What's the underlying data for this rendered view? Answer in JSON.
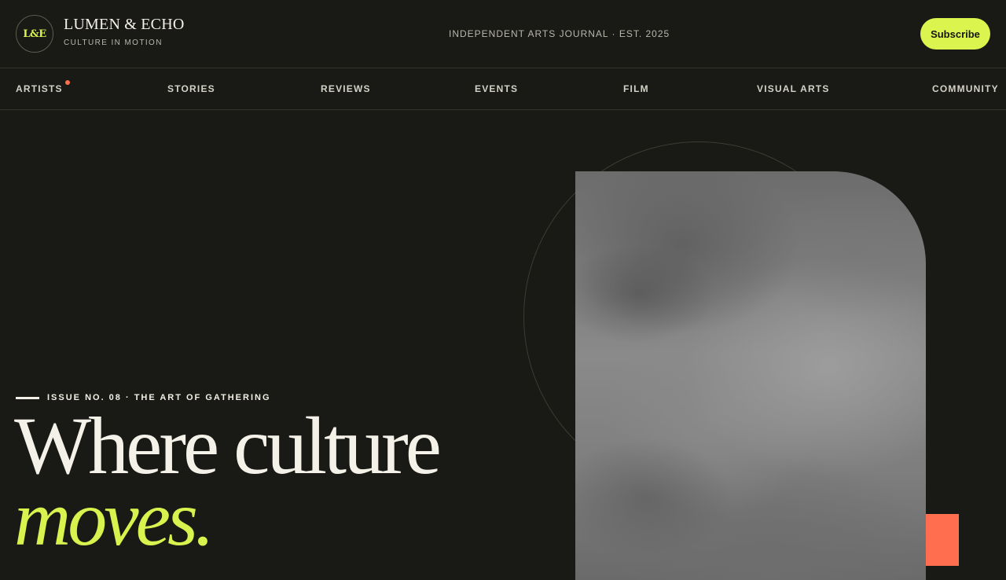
{
  "brand": {
    "mark": "L&E",
    "name": "LUMEN & ECHO",
    "tagline": "CULTURE IN MOTION"
  },
  "header": {
    "journal_tag": "INDEPENDENT ARTS JOURNAL · EST. 2025",
    "subscribe_label": "Subscribe"
  },
  "nav": {
    "items": [
      {
        "label": "ARTISTS",
        "has_notification": true
      },
      {
        "label": "STORIES"
      },
      {
        "label": "REVIEWS"
      },
      {
        "label": "EVENTS"
      },
      {
        "label": "FILM"
      },
      {
        "label": "VISUAL ARTS"
      },
      {
        "label": "COMMUNITY"
      }
    ]
  },
  "hero": {
    "kicker": "ISSUE NO. 08 · THE ART OF GATHERING",
    "headline": "Where culture",
    "headline_accent": "moves."
  },
  "colors": {
    "background": "#191a15",
    "accent_lime": "#dcf54e",
    "accent_coral": "#ff6f4f",
    "text_light": "#f4f1e8"
  }
}
